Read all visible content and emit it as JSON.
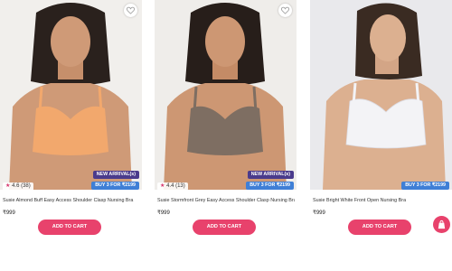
{
  "products": [
    {
      "name": "Susie Almond Buff Easy Access Shoulder Clasp Nursing Bra",
      "price": "₹999",
      "rating": "4.6 (38)",
      "badge_new": "NEW ARRIVAL(s)",
      "badge_offer": "BUY 3 FOR ₹2199",
      "cta": "ADD TO CART",
      "bra_color": "#f2a86d"
    },
    {
      "name": "Susie Stormfront Grey Easy Access Shoulder Clasp Nursing Bra",
      "price": "₹999",
      "rating": "4.4 (13)",
      "badge_new": "NEW ARRIVAL(s)",
      "badge_offer": "BUY 3 FOR ₹2199",
      "cta": "ADD TO CART",
      "bra_color": "#7e6e62"
    },
    {
      "name": "Susie Bright White Front Open Nursing Bra",
      "price": "₹999",
      "badge_offer": "BUY 3 FOR ₹2199",
      "cta": "ADD TO CART",
      "bra_color": "#f3f3f6"
    }
  ],
  "colors": {
    "accent": "#e8426c",
    "badge_new": "#4a3b8c",
    "badge_offer": "#3f7fd6"
  },
  "icons": {
    "wishlist": "heart-outline-icon",
    "fab": "shopping-icon"
  }
}
